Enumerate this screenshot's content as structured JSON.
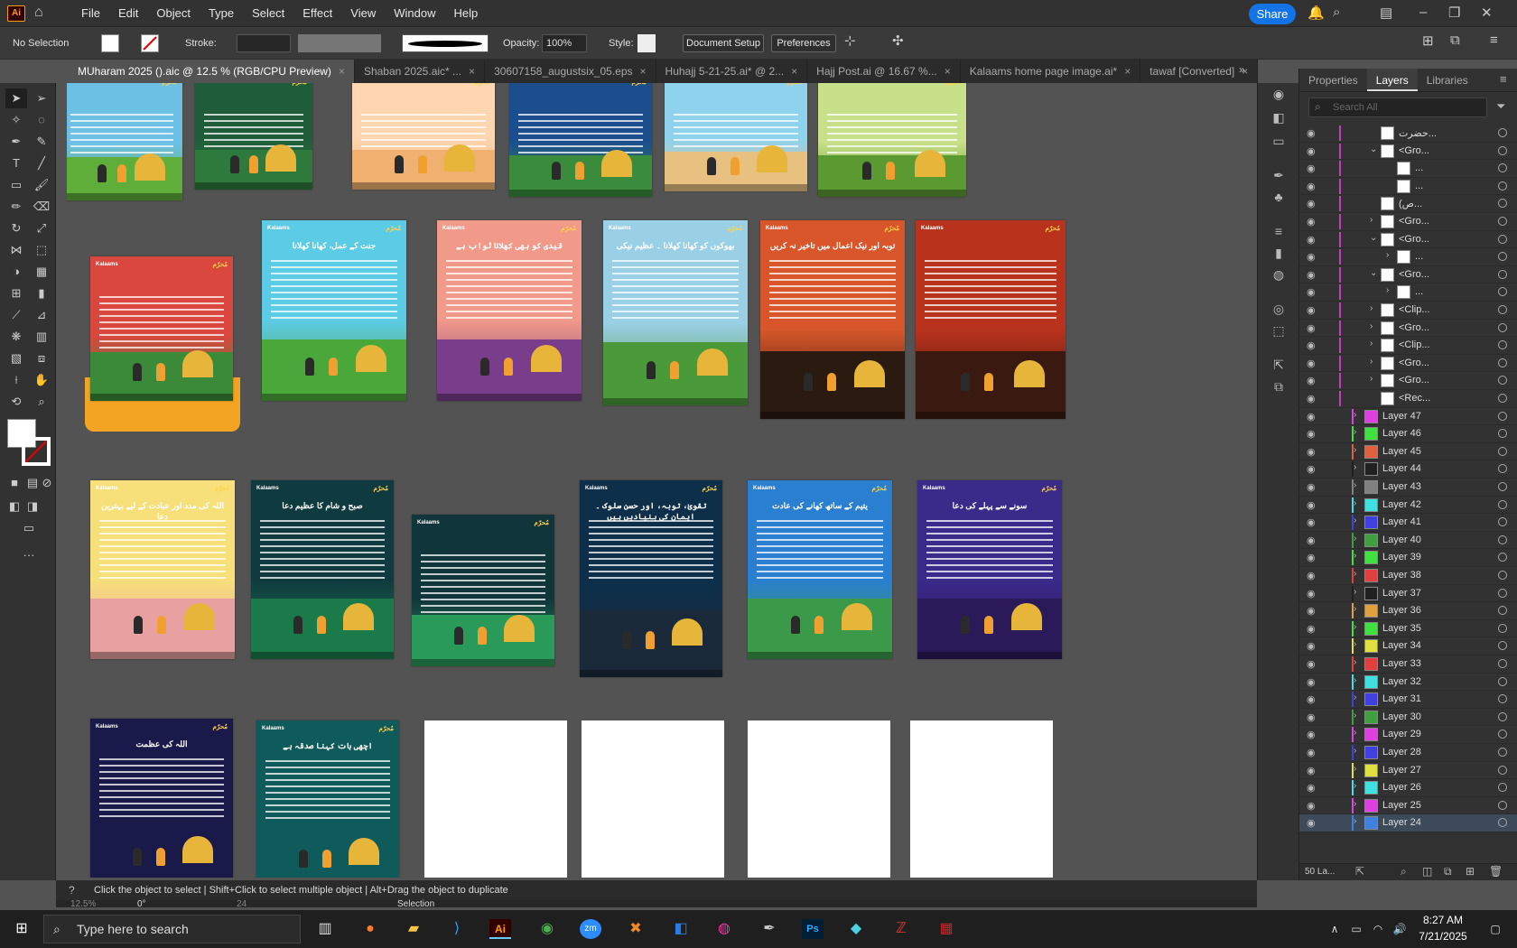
{
  "app": {
    "logo": "Ai",
    "menus": [
      "File",
      "Edit",
      "Object",
      "Type",
      "Select",
      "Effect",
      "View",
      "Window",
      "Help"
    ],
    "share": "Share"
  },
  "control": {
    "selection": "No Selection",
    "stroke_label": "Stroke:",
    "opacity_label": "Opacity:",
    "opacity": "100%",
    "style_label": "Style:",
    "document_setup": "Document Setup",
    "preferences": "Preferences"
  },
  "tabs": [
    {
      "label": "MUharam 2025 ().aic @ 12.5 % (RGB/CPU Preview)",
      "active": true
    },
    {
      "label": "Shaban 2025.aic* ..."
    },
    {
      "label": "30607158_augustsix_05.eps"
    },
    {
      "label": "Huhajj 5-21-25.ai* @ 2..."
    },
    {
      "label": "Hajj Post.ai @ 16.67 %..."
    },
    {
      "label": "Kalaams home page image.ai*"
    },
    {
      "label": "tawaf [Converted]"
    }
  ],
  "artboard": {
    "brand": "Kalaams",
    "badge": "مُحرّم"
  },
  "posts": [
    {
      "title": "",
      "bg": "#6cc0e3",
      "ground": "#5fae3a"
    },
    {
      "title": "",
      "bg": "#1f5d3a",
      "ground": "#2e7a3c"
    },
    {
      "title": "",
      "bg": "#ffd6b0",
      "ground": "#f0b070"
    },
    {
      "title": "",
      "bg": "#1c4e8e",
      "ground": "#3a8c3c"
    },
    {
      "title": "",
      "bg": "#8ed2ee",
      "ground": "#e8c080"
    },
    {
      "title": "",
      "bg": "#c9e08a",
      "ground": "#5a9a30"
    },
    {
      "title": "",
      "bg": "#d9473e",
      "ground": "#3a8a3a"
    },
    {
      "title": "جنت کے عمل، کھانا کھلانا",
      "bg": "#5ccbe6",
      "ground": "#4aa83a"
    },
    {
      "title": "قیدی کو بھی کھلانا ثواب ہے",
      "bg": "#f29a8a",
      "ground": "#7a3d8c"
    },
    {
      "title": "بھوکوں کو کھانا کھلانا ۔ عظیم نیکی",
      "bg": "#9ad0e6",
      "ground": "#4a9a3a"
    },
    {
      "title": "توبہ اور نیک اعمال میں تاخیر نہ کریں",
      "bg": "#d8562a",
      "ground": "#2a1a10"
    },
    {
      "title": "",
      "bg": "#b8321c",
      "ground": "#3a1a10"
    },
    {
      "title": "اللہ کی مدد اور عبادت کے لیے بہترین دعا",
      "bg": "#f7e07a",
      "ground": "#e8a0a0"
    },
    {
      "title": "صبح و شام کا عظیم دعا",
      "bg": "#0f3a3f",
      "ground": "#1a7a4a"
    },
    {
      "title": "",
      "bg": "#10353a",
      "ground": "#2a9a5a"
    },
    {
      "title": "تقویٰ، توبہ، اور حسن سلوک ۔ ایمان کی بنیادیں ہیں",
      "bg": "#0e2f4a",
      "ground": "#1a2a3a"
    },
    {
      "title": "یتیم کے ساتھ کھانے کی عادت",
      "bg": "#2a7fd0",
      "ground": "#3a9a4a"
    },
    {
      "title": "سونے سے پہلے کی دعا",
      "bg": "#3a2a8a",
      "ground": "#2a1a5a"
    },
    {
      "title": "اللہ کی عظمت",
      "bg": "#1a1a4a",
      "ground": "#1a1a4a"
    },
    {
      "title": "اچھی بات کہنا صدقہ ہے",
      "bg": "#0f5a5a",
      "ground": "#0f5a5a"
    }
  ],
  "right_tabs": [
    "Properties",
    "Layers",
    "Libraries"
  ],
  "search_placeholder": "Search All",
  "layers": [
    {
      "name": "حضرت...",
      "indent": 2,
      "color": "#c040c0",
      "exp": ""
    },
    {
      "name": "<Gro...",
      "indent": 2,
      "color": "#c040c0",
      "exp": "v"
    },
    {
      "name": "...",
      "indent": 3,
      "color": "#c040c0",
      "exp": ""
    },
    {
      "name": "...",
      "indent": 3,
      "color": "#c040c0",
      "exp": ""
    },
    {
      "name": "(ص...",
      "indent": 2,
      "color": "#c040c0",
      "exp": ""
    },
    {
      "name": "<Gro...",
      "indent": 2,
      "color": "#c040c0",
      "exp": ">"
    },
    {
      "name": "<Gro...",
      "indent": 2,
      "color": "#c040c0",
      "exp": "v"
    },
    {
      "name": "...",
      "indent": 3,
      "color": "#c040c0",
      "exp": ">"
    },
    {
      "name": "<Gro...",
      "indent": 2,
      "color": "#c040c0",
      "exp": "v"
    },
    {
      "name": "...",
      "indent": 3,
      "color": "#c040c0",
      "exp": ">"
    },
    {
      "name": "<Clip...",
      "indent": 2,
      "color": "#c040c0",
      "exp": ">"
    },
    {
      "name": "<Gro...",
      "indent": 2,
      "color": "#c040c0",
      "exp": ">"
    },
    {
      "name": "<Clip...",
      "indent": 2,
      "color": "#c040c0",
      "exp": ">"
    },
    {
      "name": "<Gro...",
      "indent": 2,
      "color": "#c040c0",
      "exp": ">"
    },
    {
      "name": "<Gro...",
      "indent": 2,
      "color": "#c040c0",
      "exp": ">"
    },
    {
      "name": "<Rec...",
      "indent": 2,
      "color": "#c040c0",
      "exp": ""
    },
    {
      "name": "Layer 47",
      "indent": 0,
      "color": "#e040e0",
      "exp": ">"
    },
    {
      "name": "Layer 46",
      "indent": 0,
      "color": "#40e040",
      "exp": ">"
    },
    {
      "name": "Layer 45",
      "indent": 0,
      "color": "#e06040",
      "exp": ">"
    },
    {
      "name": "Layer 44",
      "indent": 0,
      "color": "#202020",
      "exp": ">"
    },
    {
      "name": "Layer 43",
      "indent": 0,
      "color": "#808080",
      "exp": ">"
    },
    {
      "name": "Layer 42",
      "indent": 0,
      "color": "#40e0e0",
      "exp": ">"
    },
    {
      "name": "Layer 41",
      "indent": 0,
      "color": "#4040e0",
      "exp": ">"
    },
    {
      "name": "Layer 40",
      "indent": 0,
      "color": "#40a040",
      "exp": ">"
    },
    {
      "name": "Layer 39",
      "indent": 0,
      "color": "#40e040",
      "exp": ">"
    },
    {
      "name": "Layer 38",
      "indent": 0,
      "color": "#e04040",
      "exp": ">"
    },
    {
      "name": "Layer 37",
      "indent": 0,
      "color": "#202020",
      "exp": ">"
    },
    {
      "name": "Layer 36",
      "indent": 0,
      "color": "#e0a040",
      "exp": ">"
    },
    {
      "name": "Layer 35",
      "indent": 0,
      "color": "#40e040",
      "exp": ">"
    },
    {
      "name": "Layer 34",
      "indent": 0,
      "color": "#e0e040",
      "exp": ">"
    },
    {
      "name": "Layer 33",
      "indent": 0,
      "color": "#e04040",
      "exp": ">"
    },
    {
      "name": "Layer 32",
      "indent": 0,
      "color": "#40e0e0",
      "exp": ">"
    },
    {
      "name": "Layer 31",
      "indent": 0,
      "color": "#4040e0",
      "exp": ">"
    },
    {
      "name": "Layer 30",
      "indent": 0,
      "color": "#40a040",
      "exp": ">"
    },
    {
      "name": "Layer 29",
      "indent": 0,
      "color": "#e040e0",
      "exp": ">"
    },
    {
      "name": "Layer 28",
      "indent": 0,
      "color": "#4040e0",
      "exp": ">"
    },
    {
      "name": "Layer 27",
      "indent": 0,
      "color": "#e0e040",
      "exp": ">"
    },
    {
      "name": "Layer 26",
      "indent": 0,
      "color": "#40e0e0",
      "exp": ">"
    },
    {
      "name": "Layer 25",
      "indent": 0,
      "color": "#e040e0",
      "exp": ">"
    },
    {
      "name": "Layer 24",
      "indent": 0,
      "color": "#4080e0",
      "exp": ">"
    }
  ],
  "layer_count": "50 La...",
  "status": {
    "hint": "Click the object to select  |  Shift+Click to select multiple object  |  Alt+Drag the object to duplicate",
    "zoom": "12.5%",
    "rotation": "0°",
    "artboard_no": "24",
    "mode": "Selection"
  },
  "taskbar": {
    "search": "Type here to search",
    "time": "8:27 AM",
    "date": "7/21/2025"
  }
}
